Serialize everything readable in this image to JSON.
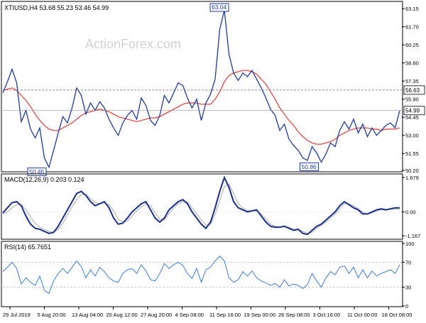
{
  "colors": {
    "background": "#ffffff",
    "border": "#000000",
    "price": "#1f3b9a",
    "ma": "#e53935",
    "macd": "#1b2f8c",
    "signal": "#b5b5b5",
    "rsi": "#3a7bd5",
    "label_box": "#1f3b9a",
    "grid": "#c8c8c8",
    "watermark": "#d2d2d2"
  },
  "watermark": "ActionForex.com",
  "chart_data": [
    {
      "type": "line",
      "name": "price",
      "title": "XTIUSD,H4 53.68 55.23 53.46 54.99",
      "ylim": [
        50.2,
        63.5
      ],
      "y_ticks": [
        "63.15",
        "61.70",
        "60.25",
        "58.80",
        "57.35",
        "55.90",
        "54.45",
        "53.00",
        "51.55",
        "50.20"
      ],
      "y_tick_values": [
        63.15,
        61.7,
        60.25,
        58.8,
        57.35,
        55.9,
        54.45,
        53.0,
        51.55,
        50.2
      ],
      "x_labels": [
        "29 Jul 2019",
        "5 Aug 20:00",
        "13 Aug 04:00",
        "20 Aug 12:00",
        "27 Aug 20:00",
        "4 Sep 08:00",
        "11 Sep 16:00",
        "19 Sep 00:00",
        "26 Sep 08:00",
        "3 Oct 16:00",
        "11 Oct 00:00",
        "18 Oct 08:00"
      ],
      "series": [
        {
          "values": [
            56.4,
            57.3,
            58.3,
            57.2,
            54.1,
            55.0,
            53.5,
            52.8,
            53.6,
            51.2,
            50.45,
            51.8,
            53.2,
            54.5,
            54.0,
            55.2,
            56.8,
            56.2,
            54.7,
            55.6,
            55.0,
            55.7,
            55.2,
            54.3,
            53.6,
            53.0,
            54.0,
            54.6,
            55.0,
            54.3,
            56.0,
            55.4,
            54.2,
            53.8,
            54.6,
            56.2,
            55.6,
            56.4,
            57.2,
            57.0,
            56.0,
            55.2,
            55.9,
            54.2,
            55.6,
            56.3,
            57.5,
            61.5,
            63.04,
            59.5,
            58.0,
            57.4,
            58.0,
            57.7,
            58.2,
            57.5,
            56.8,
            56.0,
            55.1,
            54.6,
            53.4,
            53.9,
            52.7,
            52.2,
            51.8,
            51.2,
            51.0,
            52.1,
            51.6,
            50.86,
            51.5,
            52.4,
            52.1,
            53.4,
            54.1,
            53.5,
            54.3,
            53.2,
            53.9,
            52.9,
            53.6,
            53.0,
            53.4,
            53.8,
            54.0,
            53.6,
            54.99
          ]
        },
        {
          "values": [
            56.6,
            56.7,
            56.8,
            56.6,
            56.2,
            55.8,
            55.3,
            54.7,
            54.2,
            53.8,
            53.5,
            53.4,
            53.4,
            53.6,
            53.8,
            54.0,
            54.3,
            54.6,
            54.8,
            54.9,
            55.0,
            55.1,
            55.0,
            54.9,
            54.7,
            54.5,
            54.4,
            54.3,
            54.2,
            54.1,
            54.2,
            54.3,
            54.4,
            54.4,
            54.5,
            54.7,
            54.9,
            55.1,
            55.3,
            55.5,
            55.6,
            55.6,
            55.6,
            55.5,
            55.5,
            55.5,
            55.9,
            56.5,
            57.3,
            57.8,
            58.0,
            58.1,
            58.2,
            58.2,
            58.1,
            57.9,
            57.5,
            57.1,
            56.5,
            55.9,
            55.2,
            54.7,
            54.2,
            53.8,
            53.3,
            52.9,
            52.6,
            52.4,
            52.3,
            52.3,
            52.4,
            52.5,
            52.7,
            53.0,
            53.2,
            53.4,
            53.5,
            53.6,
            53.6,
            53.6,
            53.5,
            53.5,
            53.4,
            53.5,
            53.5,
            53.5,
            53.6
          ]
        }
      ],
      "annotations": [
        {
          "text": "63.04",
          "value": 63.04
        },
        {
          "text": "50.45",
          "value": 50.45
        },
        {
          "text": "50.86",
          "value": 50.86
        },
        {
          "text": "56.63",
          "value": 56.63
        },
        {
          "text": "54.99",
          "value": 54.99
        }
      ]
    },
    {
      "type": "line",
      "name": "macd",
      "title": "MACD(12,26,9) 0.203 0.124",
      "ylim": [
        -1.3,
        1.75
      ],
      "y_ticks": [
        "1.679",
        "0.00",
        "-1.167"
      ],
      "y_tick_values": [
        1.679,
        0.0,
        -1.167
      ],
      "series": [
        {
          "values": [
            -0.05,
            0.2,
            0.45,
            0.5,
            0.3,
            -0.2,
            -0.6,
            -0.8,
            -0.85,
            -0.95,
            -1.05,
            -1.0,
            -0.7,
            -0.3,
            0.1,
            0.5,
            0.9,
            1.0,
            0.8,
            0.5,
            0.3,
            0.4,
            0.5,
            0.2,
            -0.3,
            -0.6,
            -0.55,
            -0.3,
            0.0,
            0.2,
            0.4,
            0.5,
            0.1,
            -0.3,
            -0.5,
            -0.3,
            0.1,
            0.3,
            0.5,
            0.6,
            0.4,
            0.0,
            -0.3,
            -0.6,
            -0.8,
            -0.5,
            0.2,
            1.0,
            1.68,
            1.2,
            0.5,
            0.2,
            0.1,
            0.0,
            0.05,
            0.1,
            -0.2,
            -0.5,
            -0.7,
            -0.75,
            -0.75,
            -0.7,
            -0.8,
            -0.9,
            -0.85,
            -1.05,
            -1.1,
            -0.9,
            -0.7,
            -0.6,
            -0.4,
            -0.2,
            0.0,
            0.3,
            0.5,
            0.35,
            0.2,
            0.1,
            -0.1,
            -0.1,
            0.0,
            0.1,
            0.15,
            0.1,
            0.15,
            0.2,
            0.2
          ]
        },
        {
          "values": [
            -0.1,
            0.0,
            0.2,
            0.35,
            0.35,
            0.1,
            -0.25,
            -0.55,
            -0.75,
            -0.85,
            -0.95,
            -1.0,
            -0.85,
            -0.55,
            -0.15,
            0.25,
            0.6,
            0.85,
            0.85,
            0.65,
            0.45,
            0.4,
            0.45,
            0.35,
            0.05,
            -0.35,
            -0.5,
            -0.45,
            -0.2,
            0.05,
            0.25,
            0.4,
            0.3,
            -0.05,
            -0.35,
            -0.4,
            -0.1,
            0.2,
            0.4,
            0.5,
            0.5,
            0.2,
            -0.1,
            -0.4,
            -0.65,
            -0.6,
            -0.1,
            0.55,
            1.25,
            1.35,
            0.9,
            0.4,
            0.2,
            0.05,
            0.05,
            0.05,
            -0.1,
            -0.35,
            -0.6,
            -0.7,
            -0.72,
            -0.72,
            -0.75,
            -0.85,
            -0.85,
            -0.95,
            -1.05,
            -1.0,
            -0.8,
            -0.65,
            -0.5,
            -0.3,
            -0.1,
            0.15,
            0.4,
            0.4,
            0.3,
            0.15,
            0.0,
            -0.1,
            -0.05,
            0.05,
            0.1,
            0.1,
            0.12,
            0.15,
            0.12
          ]
        }
      ]
    },
    {
      "type": "line",
      "name": "rsi",
      "title": "RSI(14) 65.7651",
      "ylim": [
        0,
        100
      ],
      "y_ticks": [
        "100",
        "70",
        "30",
        "0"
      ],
      "y_tick_values": [
        100,
        70,
        30,
        0
      ],
      "series": [
        {
          "values": [
            55,
            62,
            70,
            60,
            35,
            45,
            38,
            33,
            48,
            25,
            20,
            40,
            52,
            60,
            52,
            62,
            72,
            63,
            45,
            58,
            48,
            62,
            55,
            45,
            40,
            38,
            52,
            58,
            60,
            52,
            66,
            56,
            42,
            40,
            52,
            68,
            60,
            66,
            70,
            65,
            52,
            44,
            60,
            38,
            58,
            62,
            72,
            80,
            72,
            45,
            38,
            42,
            55,
            48,
            56,
            45,
            40,
            37,
            33,
            36,
            30,
            42,
            32,
            35,
            33,
            28,
            34,
            52,
            40,
            30,
            45,
            55,
            50,
            62,
            64,
            52,
            62,
            45,
            58,
            45,
            56,
            48,
            52,
            55,
            58,
            52,
            66
          ]
        }
      ]
    }
  ]
}
